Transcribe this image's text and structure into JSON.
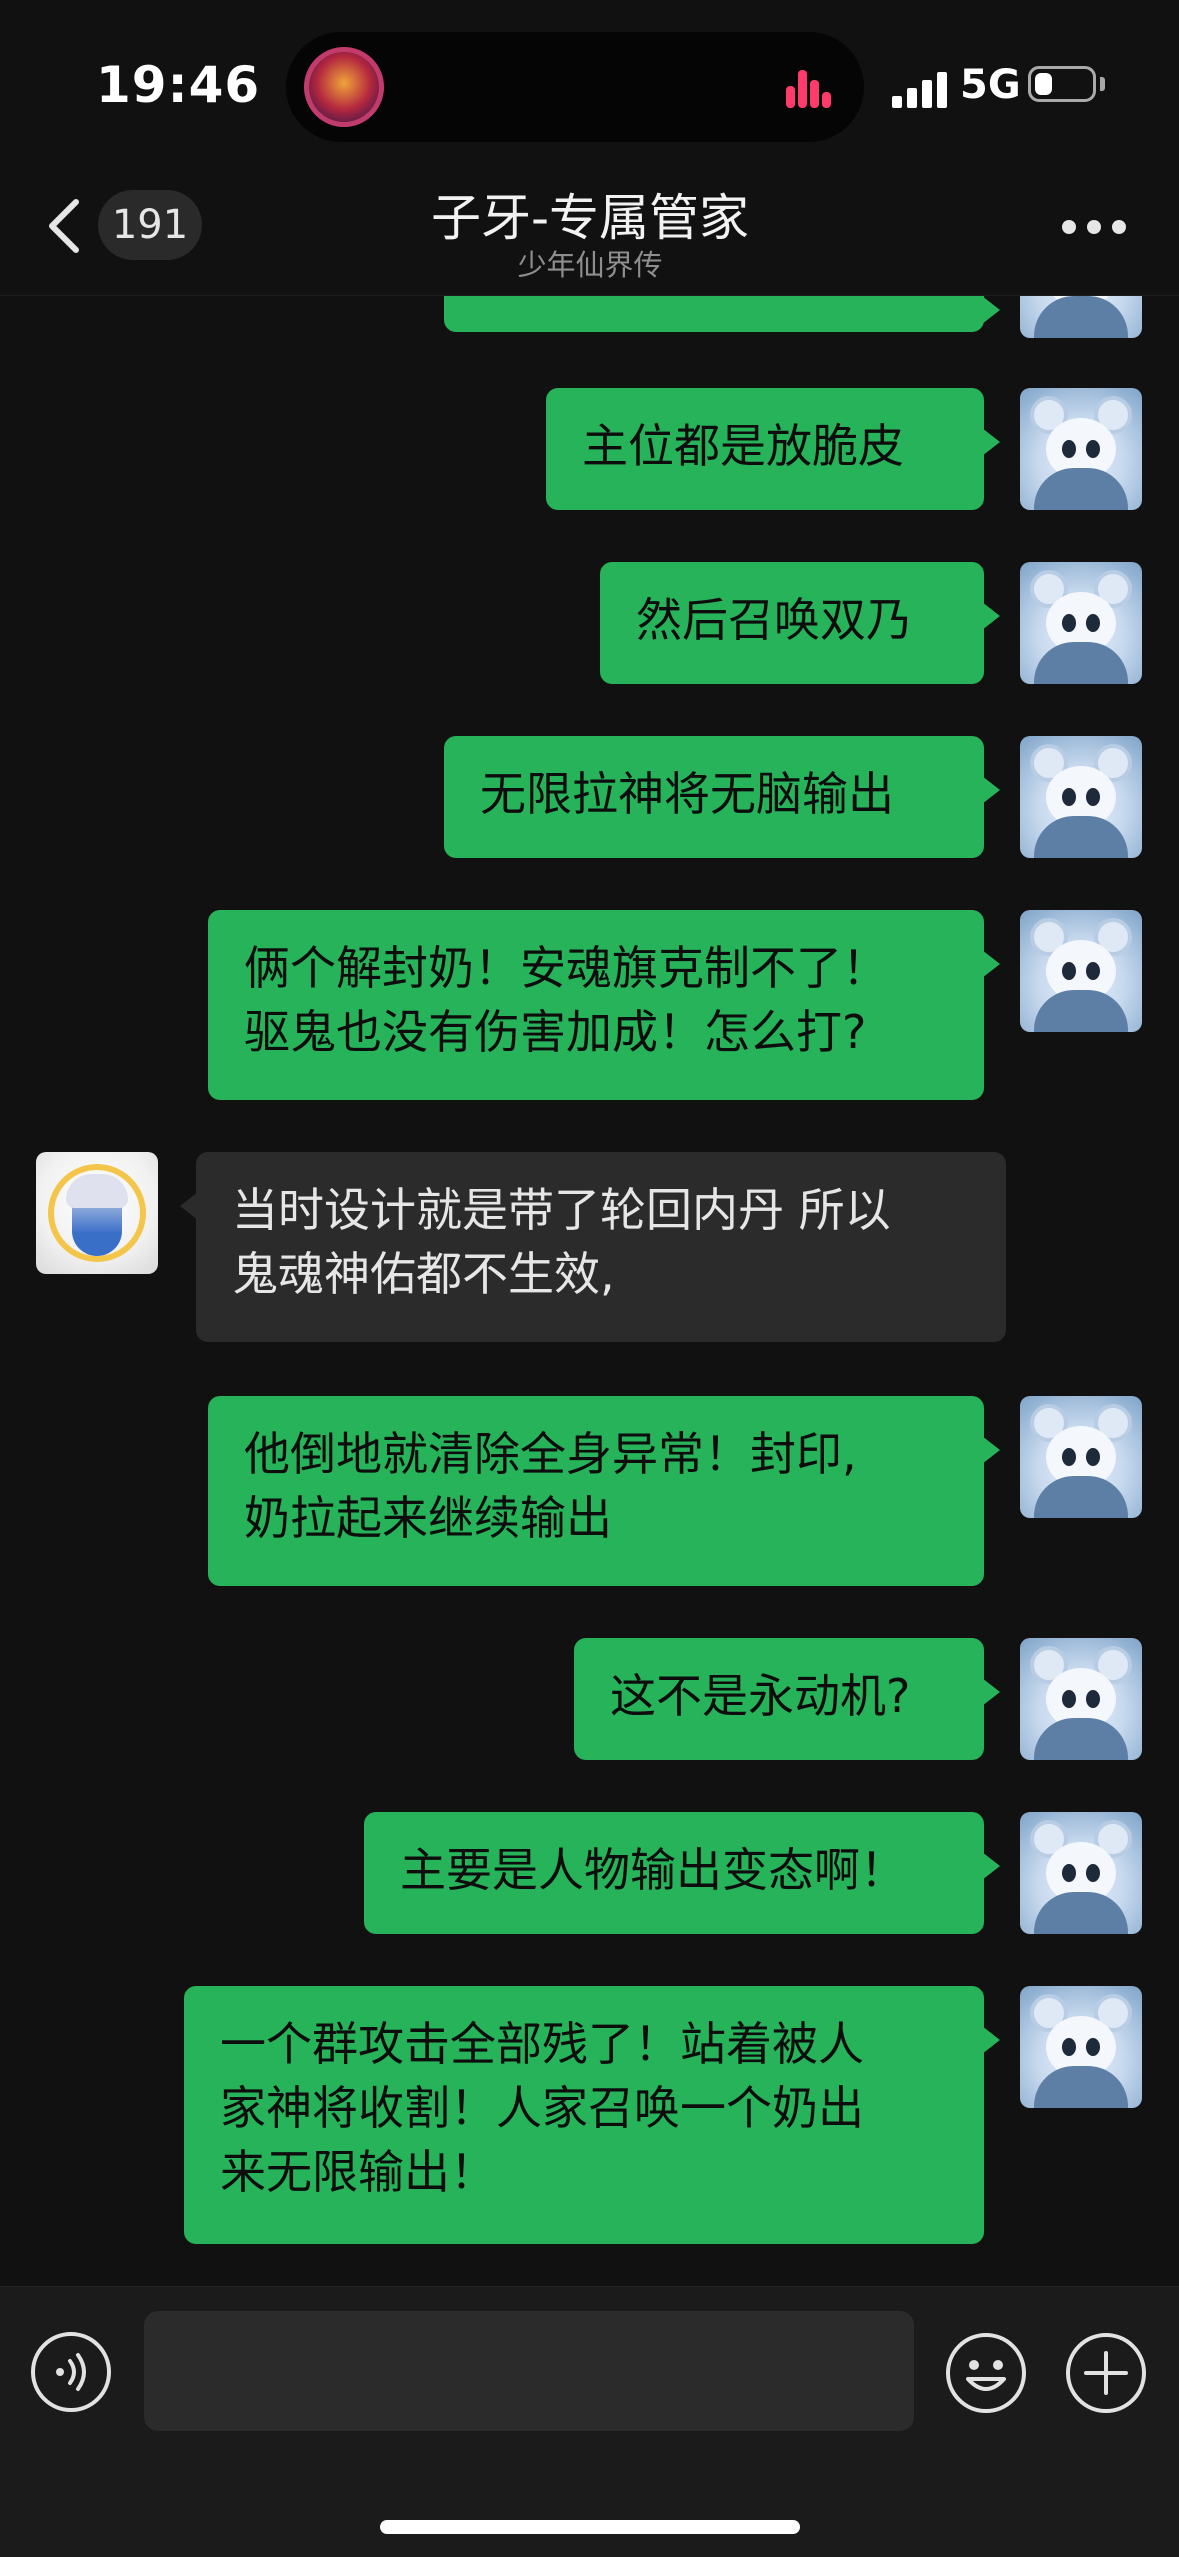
{
  "status_bar": {
    "time": "19:46",
    "network": "5G",
    "battery_level": 0.3
  },
  "nav": {
    "back_badge": "191",
    "title": "子牙-专属管家",
    "subtitle": "少年仙界传"
  },
  "messages": [
    {
      "side": "out",
      "text": "主位都是放脆皮"
    },
    {
      "side": "out",
      "text": "然后召唤双乃"
    },
    {
      "side": "out",
      "text": "无限拉神将无脑输出"
    },
    {
      "side": "out",
      "text": "俩个解封奶！安魂旗克制不了！\n驱鬼也没有伤害加成！怎么打?"
    },
    {
      "side": "in",
      "text": "当时设计就是带了轮回内丹 所以\n鬼魂神佑都不生效,"
    },
    {
      "side": "out",
      "text": "他倒地就清除全身异常！封印,\n奶拉起来继续输出"
    },
    {
      "side": "out",
      "text": "这不是永动机?"
    },
    {
      "side": "out",
      "text": "主要是人物输出变态啊！"
    },
    {
      "side": "out",
      "text": "一个群攻击全部残了！站着被人\n家神将收割！人家召唤一个奶出\n来无限输出！"
    }
  ],
  "input": {
    "value": ""
  },
  "icons": {
    "back": "chevron-left-icon",
    "more": "more-dots-icon",
    "voice": "voice-icon",
    "emoji": "emoji-icon",
    "add": "plus-icon"
  },
  "colors": {
    "outgoing_bubble": "#26b35a",
    "incoming_bubble": "#2b2b2b",
    "background": "#111111"
  }
}
